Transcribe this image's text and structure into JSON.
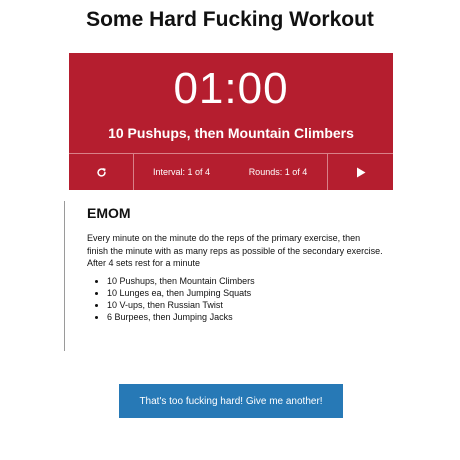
{
  "header": {
    "title": "Some Hard Fucking Workout"
  },
  "timer": {
    "display": "01:00",
    "current_exercise": "10 Pushups, then Mountain Climbers"
  },
  "controls": {
    "restart_icon": "refresh-icon",
    "play_icon": "play-icon",
    "interval_label": "Interval:",
    "interval_current": "1",
    "interval_of": "of",
    "interval_total": "4",
    "rounds_label": "Rounds:",
    "rounds_current": "1",
    "rounds_of": "of",
    "rounds_total": "4"
  },
  "workout": {
    "type": "EMOM",
    "description": "Every minute on the minute do the reps of the primary exercise, then finish the minute with as many reps as possible of the secondary exercise. After 4 sets rest for a minute",
    "exercises": [
      "10 Pushups, then Mountain Climbers",
      "10 Lunges ea, then Jumping Squats",
      "10 V-ups, then Russian Twist",
      "6 Burpees, then Jumping Jacks"
    ]
  },
  "actions": {
    "another_label": "That's too fucking hard! Give me another!"
  },
  "colors": {
    "timer_bg": "#b51e2f",
    "button_bg": "#2779b6"
  }
}
